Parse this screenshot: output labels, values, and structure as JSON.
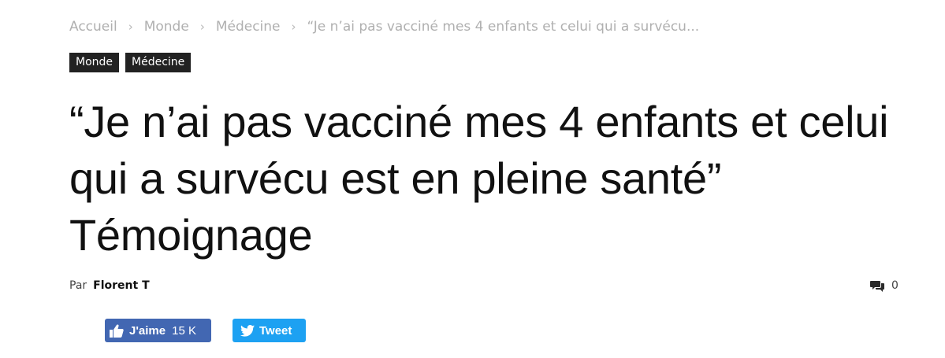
{
  "breadcrumb": {
    "items": [
      "Accueil",
      "Monde",
      "Médecine"
    ],
    "current": "“Je n’ai pas vacciné mes 4 enfants et celui qui a survécu...",
    "separator": "›"
  },
  "tags": [
    "Monde",
    "Médecine"
  ],
  "article": {
    "title": "“Je n’ai pas vacciné mes 4 enfants et celui qui a survécu est en pleine santé” Témoignage",
    "by_label": "Par",
    "author": "Florent T",
    "comment_count": "0"
  },
  "share": {
    "like_label": "J'aime",
    "like_count": "15 K",
    "tweet_label": "Tweet"
  },
  "colors": {
    "facebook": "#4267b2",
    "twitter": "#1da1f2",
    "tag_bg": "#222222",
    "breadcrumb": "#b0b0b0"
  },
  "icons": {
    "comments": "comments-icon",
    "like": "thumbs-up-icon",
    "tweet": "twitter-bird-icon"
  }
}
